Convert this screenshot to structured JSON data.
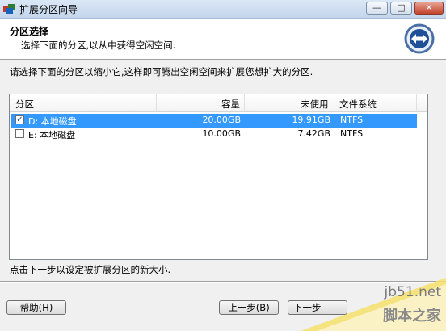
{
  "window": {
    "title": "扩展分区向导",
    "minimize_icon": "minimize-icon",
    "maximize_icon": "maximize-icon",
    "close_icon": "close-icon",
    "minimize_glyph": "—",
    "maximize_glyph": "□",
    "close_glyph": "✕"
  },
  "header": {
    "title": "分区选择",
    "subtitle": "选择下面的分区,以从中获得空闲空间."
  },
  "instruction": "请选择下面的分区以缩小它,这样即可腾出空闲空间来扩展您想扩大的分区.",
  "table": {
    "columns": [
      "分区",
      "容量",
      "未使用",
      "文件系统"
    ],
    "rows": [
      {
        "partition": "D: 本地磁盘",
        "capacity": "20.00GB",
        "unused": "19.91GB",
        "fs": "NTFS",
        "checked": true,
        "selected": true
      },
      {
        "partition": "E: 本地磁盘",
        "capacity": "10.00GB",
        "unused": "7.42GB",
        "fs": "NTFS",
        "checked": false,
        "selected": false
      }
    ]
  },
  "footer_note": "点击下一步以设定被扩展分区的新大小.",
  "buttons": {
    "help": "帮助(H)",
    "back": "上一步(B)",
    "next": "下一步"
  },
  "watermark": {
    "url": "jb51.net",
    "text": "脚本之家"
  },
  "colors": {
    "selection": "#3399ff",
    "header_bg": "#ffffff",
    "dialog_bg": "#f0f0f0",
    "watermark": "#f5e06a"
  }
}
